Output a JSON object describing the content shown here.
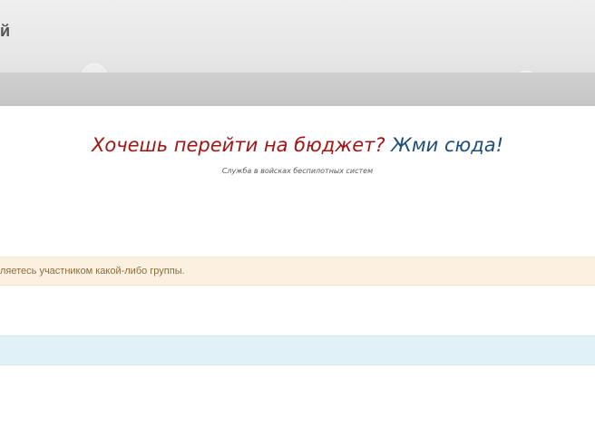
{
  "header": {
    "logo_fragment": "й"
  },
  "promo": {
    "question": "Хочешь перейти на бюджет?",
    "link_text": "Жми сюда!",
    "subtitle": "Служба в войсках беспилотных систем"
  },
  "alerts": {
    "group_notice": "ляетесь участником какой-либо группы.",
    "info_text": ""
  },
  "colors": {
    "promo_question": "#a31515",
    "promo_link": "#1f4e79",
    "warning_bg": "#fcf1e1",
    "warning_text": "#8a6d3b",
    "info_bg": "#e0f1f8"
  }
}
